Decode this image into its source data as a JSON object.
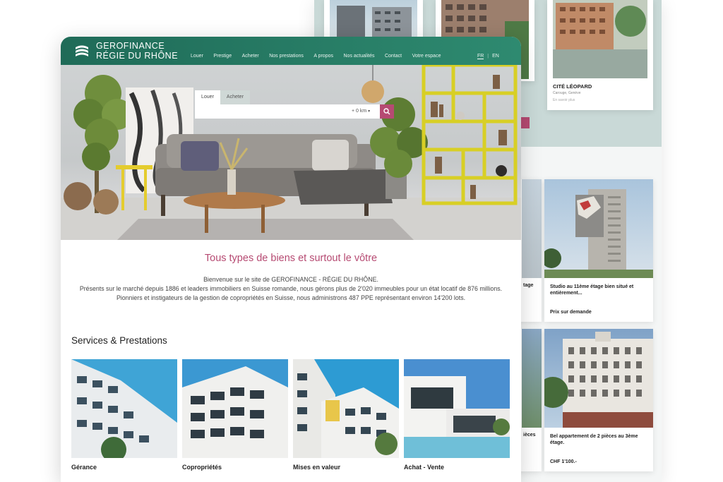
{
  "header": {
    "brand_line1": "GEROFINANCE",
    "brand_line2": "RÉGIE DU RHÔNE",
    "nav": [
      "Louer",
      "Prestige",
      "Acheter",
      "Nos prestations",
      "A propos",
      "Nos actualités",
      "Contact",
      "Votre espace"
    ],
    "lang": [
      "FR",
      "EN"
    ],
    "colors": {
      "header_green": "#2e8a70",
      "accent_pink": "#b64a72"
    }
  },
  "search": {
    "tabs": [
      "Louer",
      "Acheter"
    ],
    "active_tab": "Louer",
    "placeholder": "",
    "radius": "+ 0 km",
    "button_icon": "search-icon"
  },
  "main": {
    "title": "Tous types de biens et surtout le vôtre",
    "intro_line1": "Bienvenue sur le site de GEROFINANCE - RÉGIE DU RHÔNE.",
    "intro_line2": "Présents sur le marché depuis 1886 et leaders immobiliers en Suisse romande, nous gérons plus de 2'020 immeubles pour un état locatif de 876 millions. Pionniers et instigateurs de la gestion de copropriétés en Suisse, nous administrons 487 PPE représentant environ 14'200 lots.",
    "services_title": "Services & Prestations",
    "services": [
      "Gérance",
      "Copropriétés",
      "Mises en valeur",
      "Achat - Vente"
    ]
  },
  "back_page": {
    "cite_card": {
      "title": "CITÉ LÉOPARD",
      "subtitle": "Carouge, Genève",
      "note": "En savoir plus"
    },
    "listing1": {
      "title": "Studio au 11ème étage bien situé et entièrement...",
      "meta1": "",
      "meta2": "",
      "price": "Prix sur demande"
    },
    "listing2": {
      "title": "Bel appartement de 2 pièces au 3ème étage.",
      "meta1": "",
      "meta2": "",
      "price": "CHF 1'100.-"
    },
    "partial_left1": "tage",
    "partial_left2": "ièces"
  }
}
